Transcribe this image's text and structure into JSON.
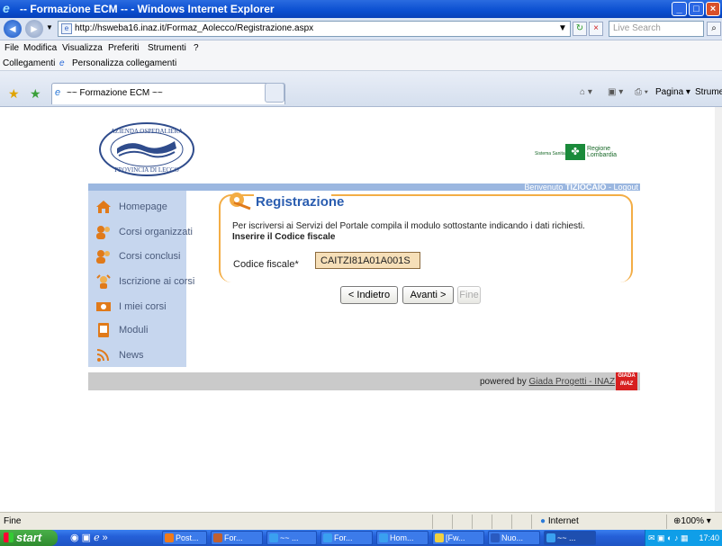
{
  "window": {
    "title": "-- Formazione ECM -- - Windows Internet Explorer"
  },
  "address": {
    "url": "http://hsweba16.inaz.it/Formaz_Aolecco/Registrazione.aspx",
    "search_placeholder": "Live Search"
  },
  "menu": [
    "File",
    "Modifica",
    "Visualizza",
    "Preferiti",
    "Strumenti",
    "?"
  ],
  "links": {
    "label": "Collegamenti",
    "item": "Personalizza collegamenti"
  },
  "tab": {
    "title": "~~ Formazione ECM ~~"
  },
  "toolbar": {
    "pagina": "Pagina",
    "strumenti": "Strumenti"
  },
  "header": {
    "left_logo_text": "AZIENDA OSPEDALIERA PROVINCIA DI LECCO",
    "sistema": "Sistema Sanitario",
    "regione": "Regione Lombardia",
    "welcome": "Benvenuto",
    "user": "TIZIOCAIO",
    "separator": "-",
    "logout": "Logout"
  },
  "sidebar": {
    "items": [
      {
        "label": "Homepage",
        "icon": "home-icon"
      },
      {
        "label": "Corsi organizzati",
        "icon": "users-icon"
      },
      {
        "label": "Corsi conclusi",
        "icon": "users-icon"
      },
      {
        "label": "Iscrizione ai corsi",
        "icon": "signup-icon"
      },
      {
        "label": "I miei corsi",
        "icon": "my-courses-icon"
      },
      {
        "label": "Moduli",
        "icon": "forms-icon"
      },
      {
        "label": "News",
        "icon": "rss-icon"
      }
    ]
  },
  "form": {
    "title": "Registrazione",
    "intro": "Per iscriversi ai Servizi del Portale compila il modulo sottostante indicando i dati richiesti.",
    "instruction": "Inserire il Codice fiscale",
    "cf_label": "Codice fiscale*",
    "cf_value": "CAITZI81A01A001S",
    "back": "< Indietro",
    "next": "Avanti >",
    "finish": "Fine"
  },
  "footer": {
    "powered": "powered by",
    "company": "Giada Progetti - INAZ",
    "giada_top": "GIADA",
    "giada_bottom": "INAZ"
  },
  "status": {
    "text": "Fine",
    "zone": "Internet",
    "zoom": "100%"
  },
  "taskbar": {
    "start": "start",
    "tasks": [
      "Post...",
      "For...",
      "~~ ...",
      "For...",
      "Hom...",
      "[Fw...",
      "Nuo...",
      "~~ ..."
    ],
    "clock": "17:40"
  },
  "colors": {
    "accent": "#f3ad45",
    "title_blue": "#2a5db0",
    "sidebar": "#c6d6ee",
    "input_bg": "#f6dfb8"
  }
}
